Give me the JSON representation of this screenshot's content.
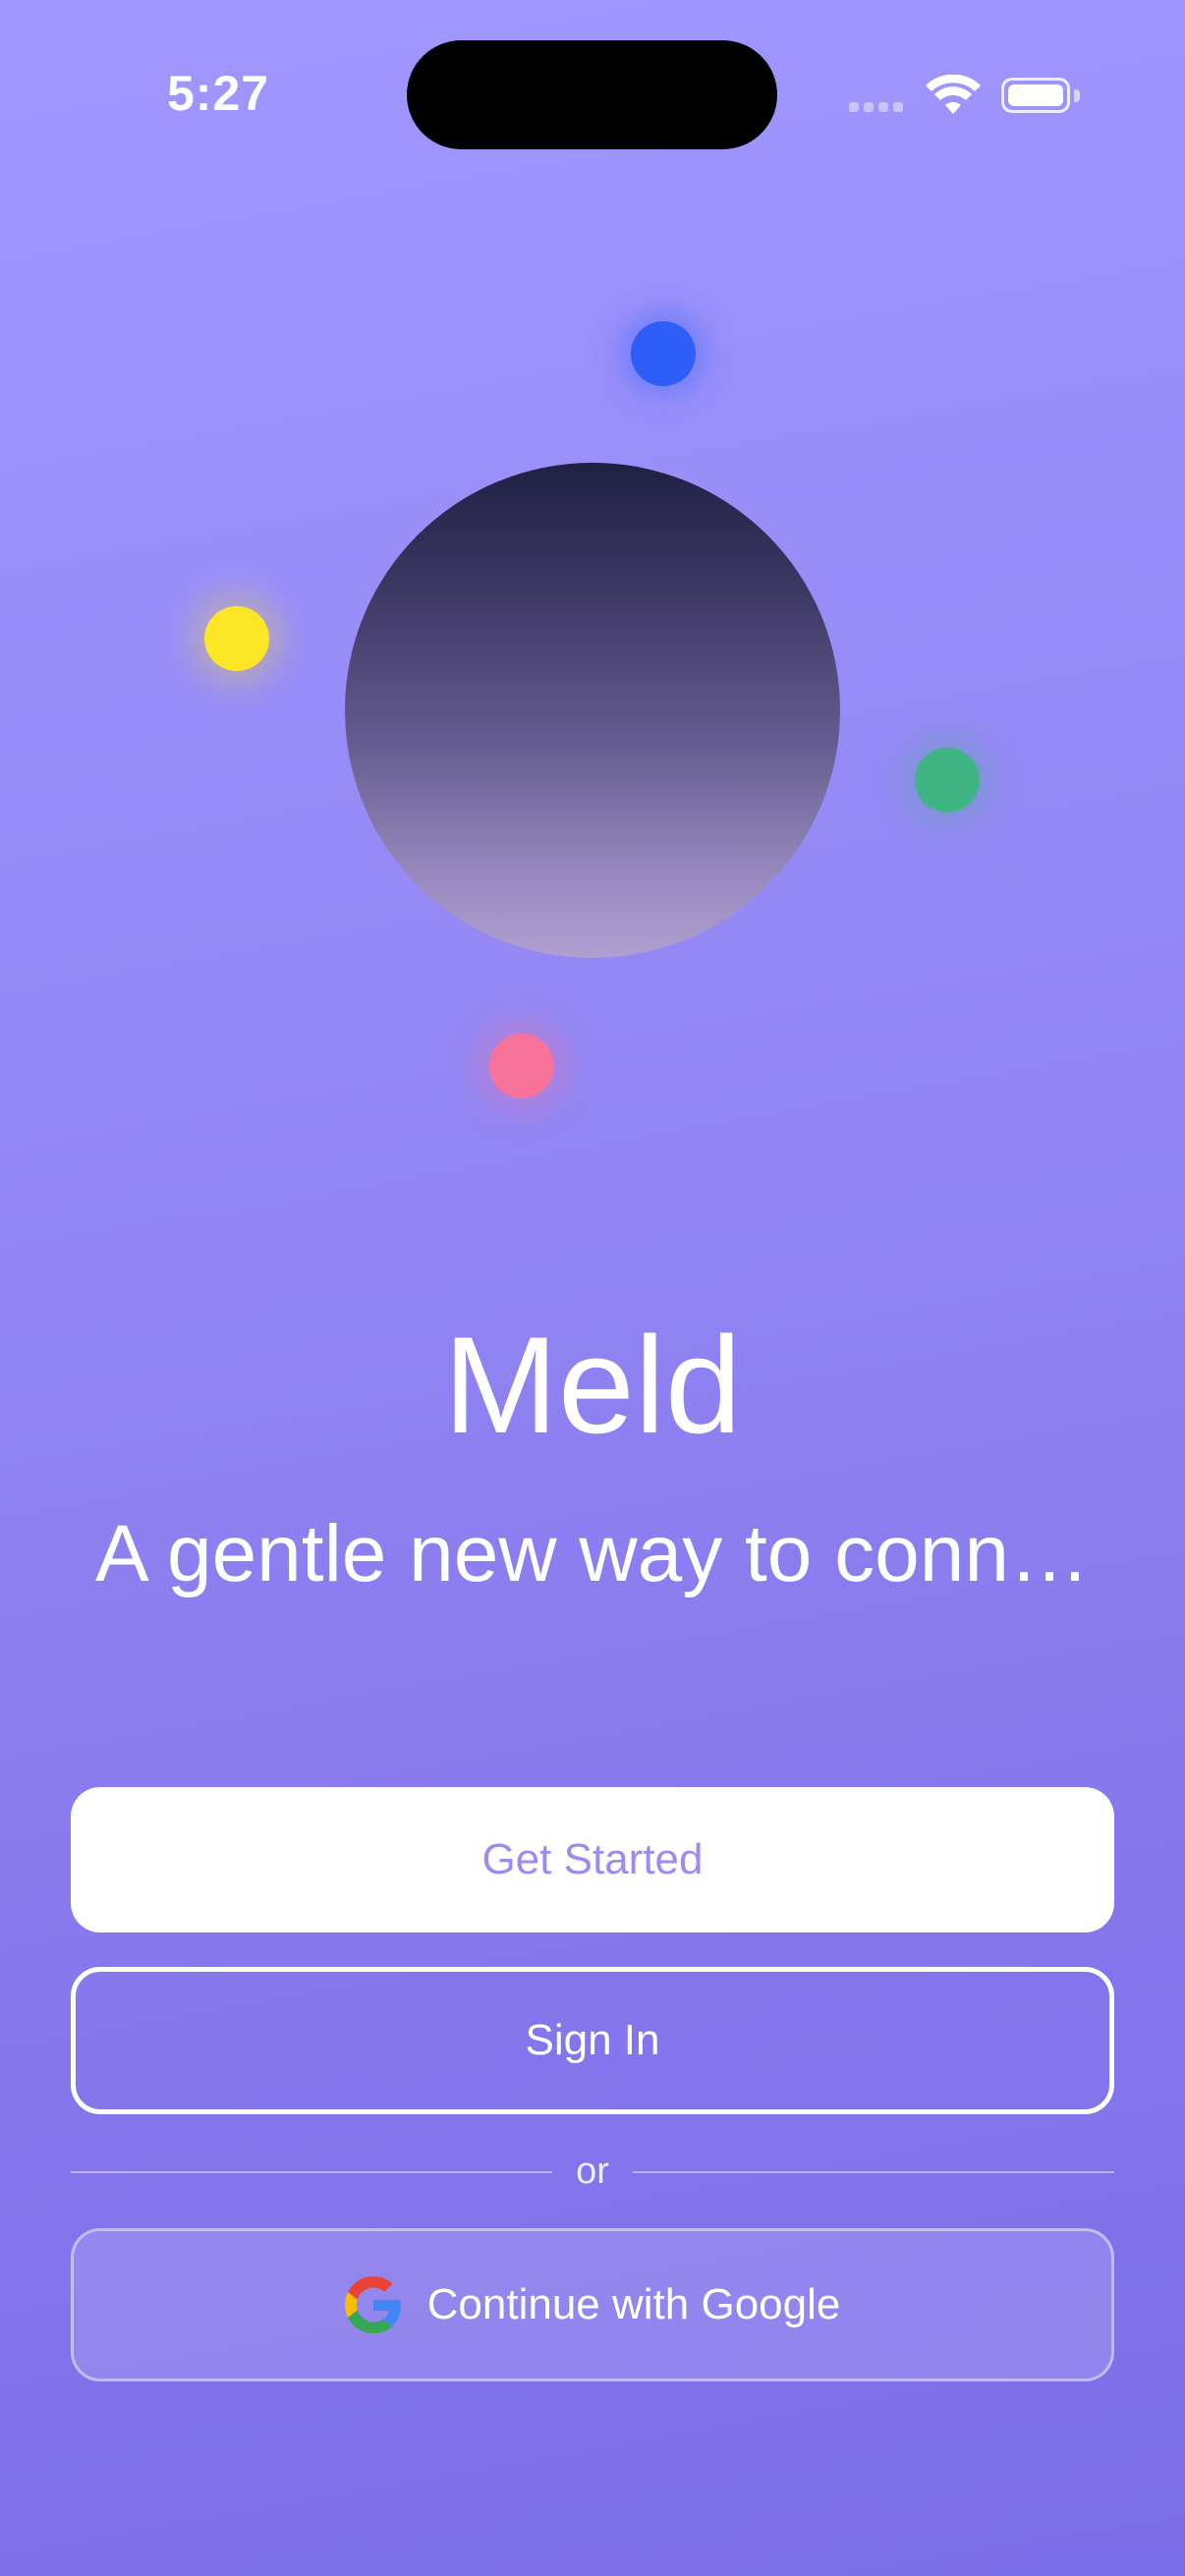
{
  "status_bar": {
    "time": "5:27",
    "icons": [
      "cellular-signal-icon",
      "wifi-icon",
      "battery-icon"
    ]
  },
  "hero": {
    "orb_gradient": [
      "#1f2043",
      "#b09fd0"
    ],
    "dots": [
      {
        "name": "blue-dot",
        "color": "#2e5ef7"
      },
      {
        "name": "yellow-dot",
        "color": "#fde626"
      },
      {
        "name": "green-dot",
        "color": "#3fb584"
      },
      {
        "name": "pink-dot",
        "color": "#f7739c"
      }
    ]
  },
  "app": {
    "title": "Meld",
    "tagline": "A gentle new way to conn…"
  },
  "actions": {
    "get_started": "Get Started",
    "sign_in": "Sign In",
    "divider_text": "or",
    "google": "Continue with Google"
  },
  "colors": {
    "background_top": "#a097ff",
    "background_bottom": "#7c6ee8",
    "primary_button_bg": "#ffffff",
    "primary_button_text": "#9b8df0"
  }
}
